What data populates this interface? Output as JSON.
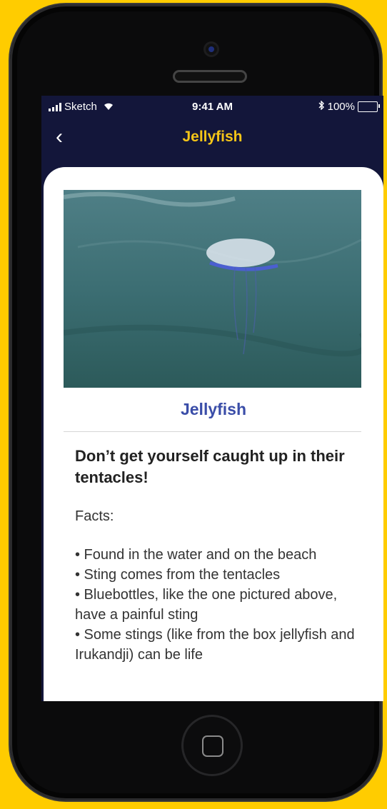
{
  "status_bar": {
    "carrier": "Sketch",
    "time": "9:41 AM",
    "battery": "100%"
  },
  "nav": {
    "back_glyph": "‹",
    "title": "Jellyfish"
  },
  "card": {
    "title": "Jellyfish",
    "headline": "Don’t get yourself caught up in their tentacles!",
    "facts_label": "Facts:",
    "facts": [
      "• Found in the water and on the beach",
      "• Sting comes from the tentacles",
      "• Bluebottles, like the one pictured above, have a painful sting",
      "• Some stings (like from the box jellyfish and Irukandji) can be life"
    ]
  },
  "colors": {
    "background": "#FFCC00",
    "nav_bg": "#13163A",
    "nav_title": "#F5C518",
    "card_title": "#3A4DA8"
  }
}
